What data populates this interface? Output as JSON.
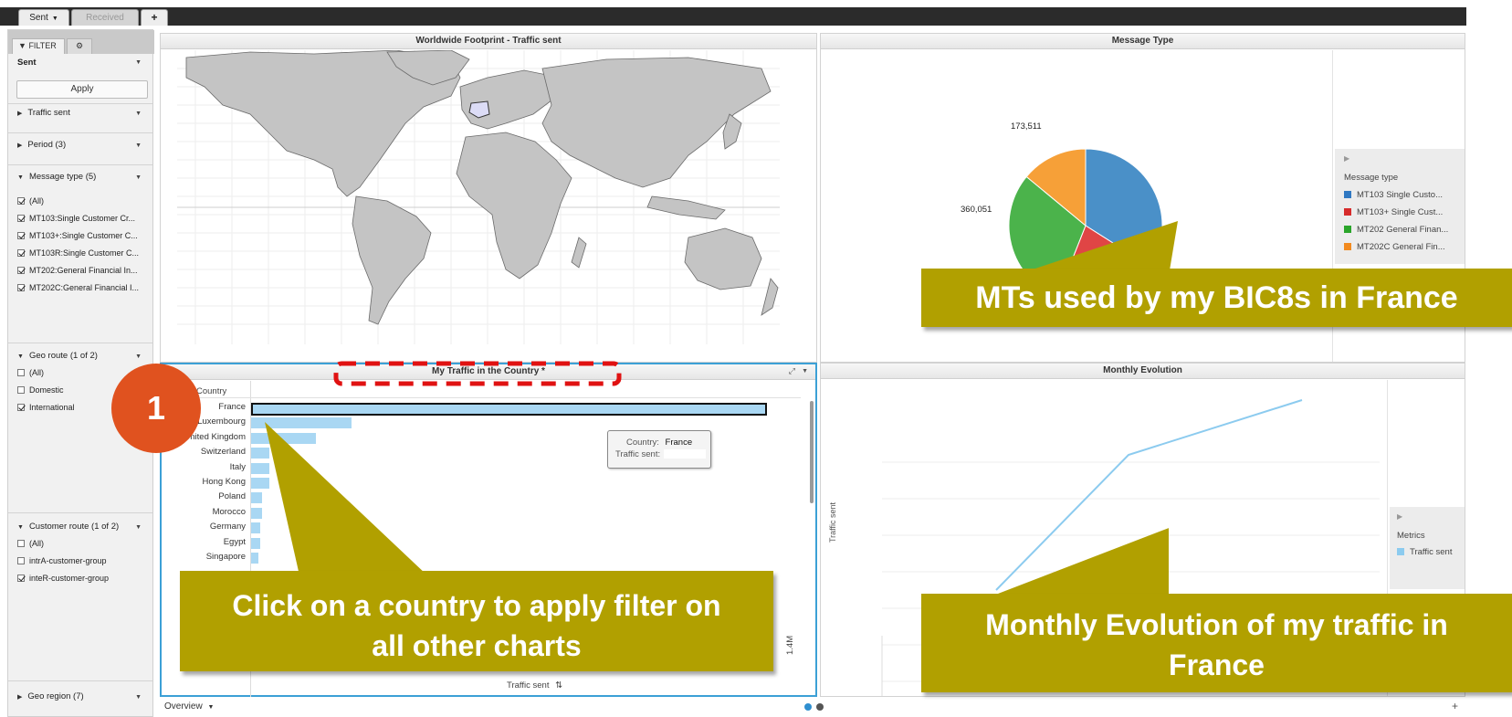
{
  "tabs": {
    "sent": "Sent",
    "received": "Received",
    "add": "+"
  },
  "sidebar": {
    "filter_tab": "FILTER",
    "selection": "Sent",
    "apply": "Apply",
    "sections": {
      "traffic": "Traffic sent",
      "period": "Period (3)",
      "message_type": "Message type (5)",
      "geo_route": "Geo route (1 of 2)",
      "customer_route": "Customer route (1 of 2)",
      "geo_region": "Geo region (7)"
    },
    "message_type_items": [
      "(All)",
      "MT103:Single Customer Cr...",
      "MT103+:Single Customer C...",
      "MT103R:Single Customer C...",
      "MT202:General Financial In...",
      "MT202C:General Financial I..."
    ],
    "geo_route_items": [
      "(All)",
      "Domestic",
      "International"
    ],
    "customer_route_items": [
      "(All)",
      "intrA-customer-group",
      "inteR-customer-group"
    ]
  },
  "panels": {
    "map_title": "Worldwide Footprint - Traffic sent",
    "pie_title": "Message Type",
    "bar_title": "My Traffic in the Country *",
    "line_title": "Monthly Evolution"
  },
  "pie": {
    "legend_title": "Message type",
    "legend": [
      "MT103 Single Custo...",
      "MT103+ Single Cust...",
      "MT202 General Finan...",
      "MT202C General Fin..."
    ],
    "colors": [
      "#4a90c8",
      "#e04545",
      "#4bb34b",
      "#f6a038"
    ],
    "labels": [
      "173,511",
      "360,051"
    ],
    "slice_fractions": [
      0.34,
      0.22,
      0.3,
      0.14
    ]
  },
  "bar_chart": {
    "column_header": "Country",
    "countries": [
      "France",
      "Luxembourg",
      "United Kingdom",
      "Switzerland",
      "Italy",
      "Hong Kong",
      "Poland",
      "Morocco",
      "Germany",
      "Egypt",
      "Singapore"
    ],
    "value_fractions": [
      1.0,
      0.195,
      0.125,
      0.035,
      0.035,
      0.035,
      0.022,
      0.022,
      0.017,
      0.017,
      0.014
    ],
    "axis_label": "Traffic sent",
    "axis_tick": "1.4M",
    "tooltip_country_label": "Country:",
    "tooltip_country_value": "France",
    "tooltip_traffic_label": "Traffic sent:"
  },
  "line_chart": {
    "y_axis_label": "Traffic sent",
    "legend_title": "Metrics",
    "legend_item": "Traffic sent"
  },
  "callouts": {
    "pie": "MTs used by my BIC8s in France",
    "bar": "Click on a country to apply filter on all other charts",
    "line": "Monthly Evolution of my traffic in France",
    "badge": "1"
  },
  "footer": {
    "page": "Overview",
    "add": "+"
  }
}
